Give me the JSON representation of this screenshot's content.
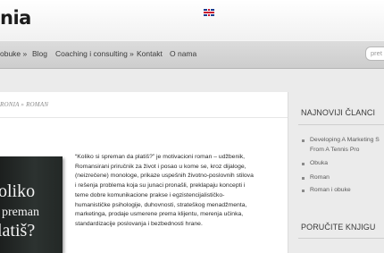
{
  "site": {
    "logo_text": "nia"
  },
  "nav": {
    "items": [
      {
        "label": "obuke »"
      },
      {
        "label": "Blog"
      },
      {
        "label": "Coaching i consulting »"
      },
      {
        "label": "Kontakt"
      },
      {
        "label": "O nama"
      }
    ],
    "flag_icon": "uk-flag-icon",
    "search_placeholder": "pret"
  },
  "breadcrumb": "RONIA » ROMAN",
  "book_cover": {
    "line1": "oliko",
    "line2": "preman",
    "line3": "latiš?"
  },
  "article": {
    "text": "“Koliko si spreman da platiš?” je motivacioni roman – udžbenik, Romansirani priručnik za život i posao u kome se, kroz dijaloge, (neizrečene) monologe, prikaze uspešnih životno-poslovnih stilova i rešenja problema koja su junaci pronašli, preklapaju koncepti i teme dobre komunikacione prakse i egzistencijalističko-humanističke psihologije, duhovnosti, strateškog menadžmenta, marketinga, prodaje usmerene prema klijentu, merenja učinka, standardizacije poslovanja i bezbednosti hrane."
  },
  "sidebar": {
    "latest_title": "NAJNOVIJI ČLANCI",
    "latest_items": [
      {
        "label_line1": "Developing A Marketing S",
        "label_line2": "From A Tennis Pro"
      },
      {
        "label_line1": "Obuka"
      },
      {
        "label_line1": "Roman"
      },
      {
        "label_line1": "Roman i obuke"
      }
    ],
    "order_title": "PORUČITE KNJIGU"
  }
}
